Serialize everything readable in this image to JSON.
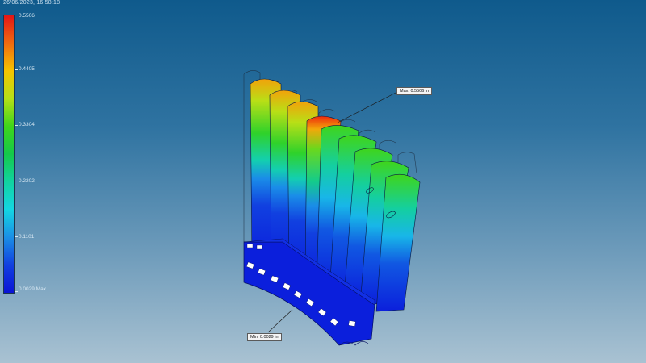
{
  "header": {
    "timestamp": "26/06/2023, 16:58:18"
  },
  "legend": {
    "colors": [
      "#e31515",
      "#f06a10",
      "#f5c400",
      "#3fd51b",
      "#14d6e3",
      "#1140e0"
    ],
    "ticks": [
      {
        "label": "0.5506"
      },
      {
        "label": "0.4405"
      },
      {
        "label": "0.3304"
      },
      {
        "label": "0.2202"
      },
      {
        "label": "0.1101"
      },
      {
        "label": "0.0029 Max"
      }
    ]
  },
  "callouts": {
    "max_label": "Max: 0.5506 in",
    "min_label": "Min: 0.0029 in"
  },
  "model": {
    "description_icon": "deflection-fringe-model",
    "colors": {
      "max": "#ee2a0c",
      "min": "#0b1fdc"
    }
  }
}
